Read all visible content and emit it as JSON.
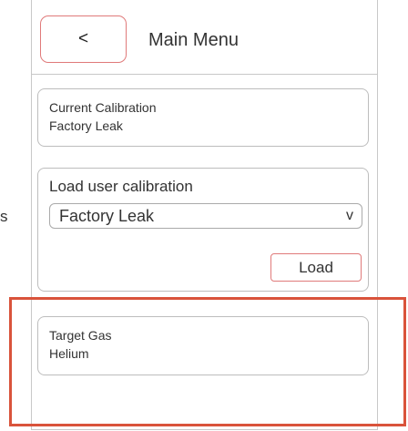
{
  "stray_text": "s",
  "header": {
    "back_label": "<",
    "title": "Main Menu"
  },
  "current_calibration": {
    "label": "Current Calibration",
    "value": "Factory Leak"
  },
  "load_user_calibration": {
    "title": "Load user calibration",
    "selected": "Factory Leak",
    "dropdown_glyph": "v",
    "load_label": "Load"
  },
  "target_gas": {
    "label": "Target Gas",
    "value": "Helium"
  },
  "colors": {
    "button_border": "#e07a7a",
    "highlight_frame": "#d9533b",
    "card_border": "#bdbdbd"
  }
}
